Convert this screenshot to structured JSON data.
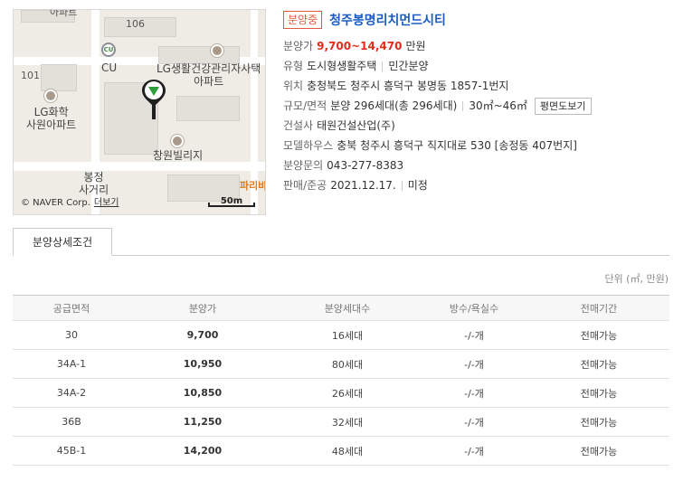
{
  "map": {
    "labels": {
      "apt_top": "아파트",
      "n106": "106",
      "n101": "101",
      "cu": "CU",
      "lg_health": "LG생활건강관리자사택\n아파트",
      "lg_chem": "LG화학\n사원아파트",
      "changwon": "창원빌리지",
      "bongjeong": "봉정\n사거리",
      "paris": "파리바"
    },
    "cu_icon_text": "CU",
    "copyright": "© NAVER Corp.",
    "more_link": "더보기",
    "scale": "50m"
  },
  "listing": {
    "badge": "분양중",
    "title": "청주봉명리치먼드시티",
    "price_key": "분양가",
    "price_value": "9,700~14,470",
    "price_unit": "만원",
    "type_key": "유형",
    "type_value": "도시형생활주택",
    "type_value2": "민간분양",
    "location_key": "위치",
    "location_value": "충청북도 청주시 흥덕구 봉명동 1857-1번지",
    "scale_key": "규모/면적",
    "scale_value": "분양 296세대(총 296세대)",
    "area_value": "30㎡~46㎡",
    "floorplan_button": "평면도보기",
    "builder_key": "건설사",
    "builder_value": "태원건설산업(주)",
    "modelhouse_key": "모델하우스",
    "modelhouse_value": "충북 청주시 흥덕구 직지대로 530 [송정동 407번지]",
    "inquiry_key": "분양문의",
    "inquiry_value": "043-277-8383",
    "sale_key": "판매/준공",
    "sale_value": "2021.12.17.",
    "sale_value2": "미정"
  },
  "tabs": {
    "detail": "분양상세조건"
  },
  "unit_note": "단위 (㎡, 만원)",
  "table": {
    "headers": [
      "공급면적",
      "분양가",
      "분양세대수",
      "방수/욕실수",
      "전매기간"
    ],
    "rows": [
      [
        "30",
        "9,700",
        "16세대",
        "-/-개",
        "전매가능"
      ],
      [
        "34A-1",
        "10,950",
        "80세대",
        "-/-개",
        "전매가능"
      ],
      [
        "34A-2",
        "10,850",
        "26세대",
        "-/-개",
        "전매가능"
      ],
      [
        "36B",
        "11,250",
        "32세대",
        "-/-개",
        "전매가능"
      ],
      [
        "45B-1",
        "14,200",
        "48세대",
        "-/-개",
        "전매가능"
      ]
    ]
  },
  "colors": {
    "accent_blue": "#1a5cc4",
    "price_red": "#e32b1e",
    "badge_red": "#e15a3f",
    "pin_green": "#2e9e3a"
  }
}
